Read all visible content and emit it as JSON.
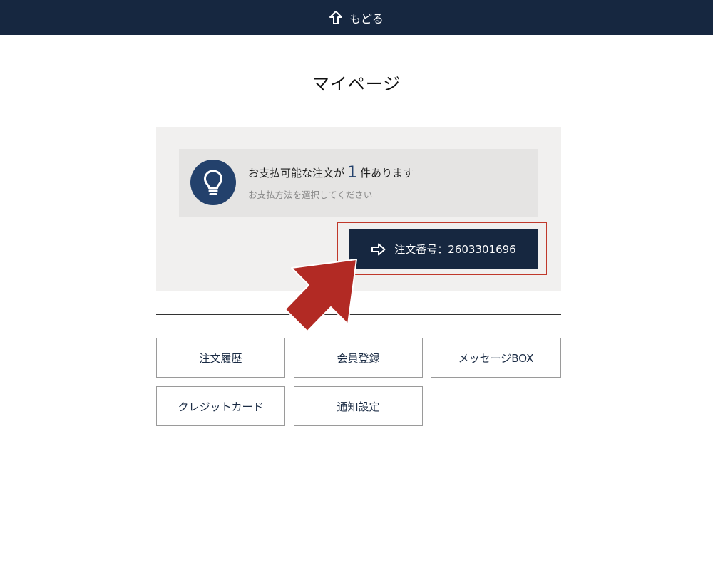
{
  "header": {
    "back_label": "もどる",
    "back_icon": "arrow-up-icon"
  },
  "page": {
    "title": "マイページ"
  },
  "notice": {
    "icon": "lightbulb-icon",
    "text_before": "お支払可能な注文が",
    "count": "1",
    "text_after": "件あります",
    "sub_text": "お支払方法を選択してください"
  },
  "order_button": {
    "icon": "arrow-right-icon",
    "label": "注文番号：2603301696"
  },
  "menu": {
    "items": [
      {
        "label": "注文履歴"
      },
      {
        "label": "会員登録"
      },
      {
        "label": "メッセージBOX"
      },
      {
        "label": "クレジットカード"
      },
      {
        "label": "通知設定"
      }
    ]
  },
  "colors": {
    "navy": "#162740",
    "accent_blue": "#23416c",
    "highlight_red": "#c0392b",
    "arrow_red": "#b22a24"
  }
}
